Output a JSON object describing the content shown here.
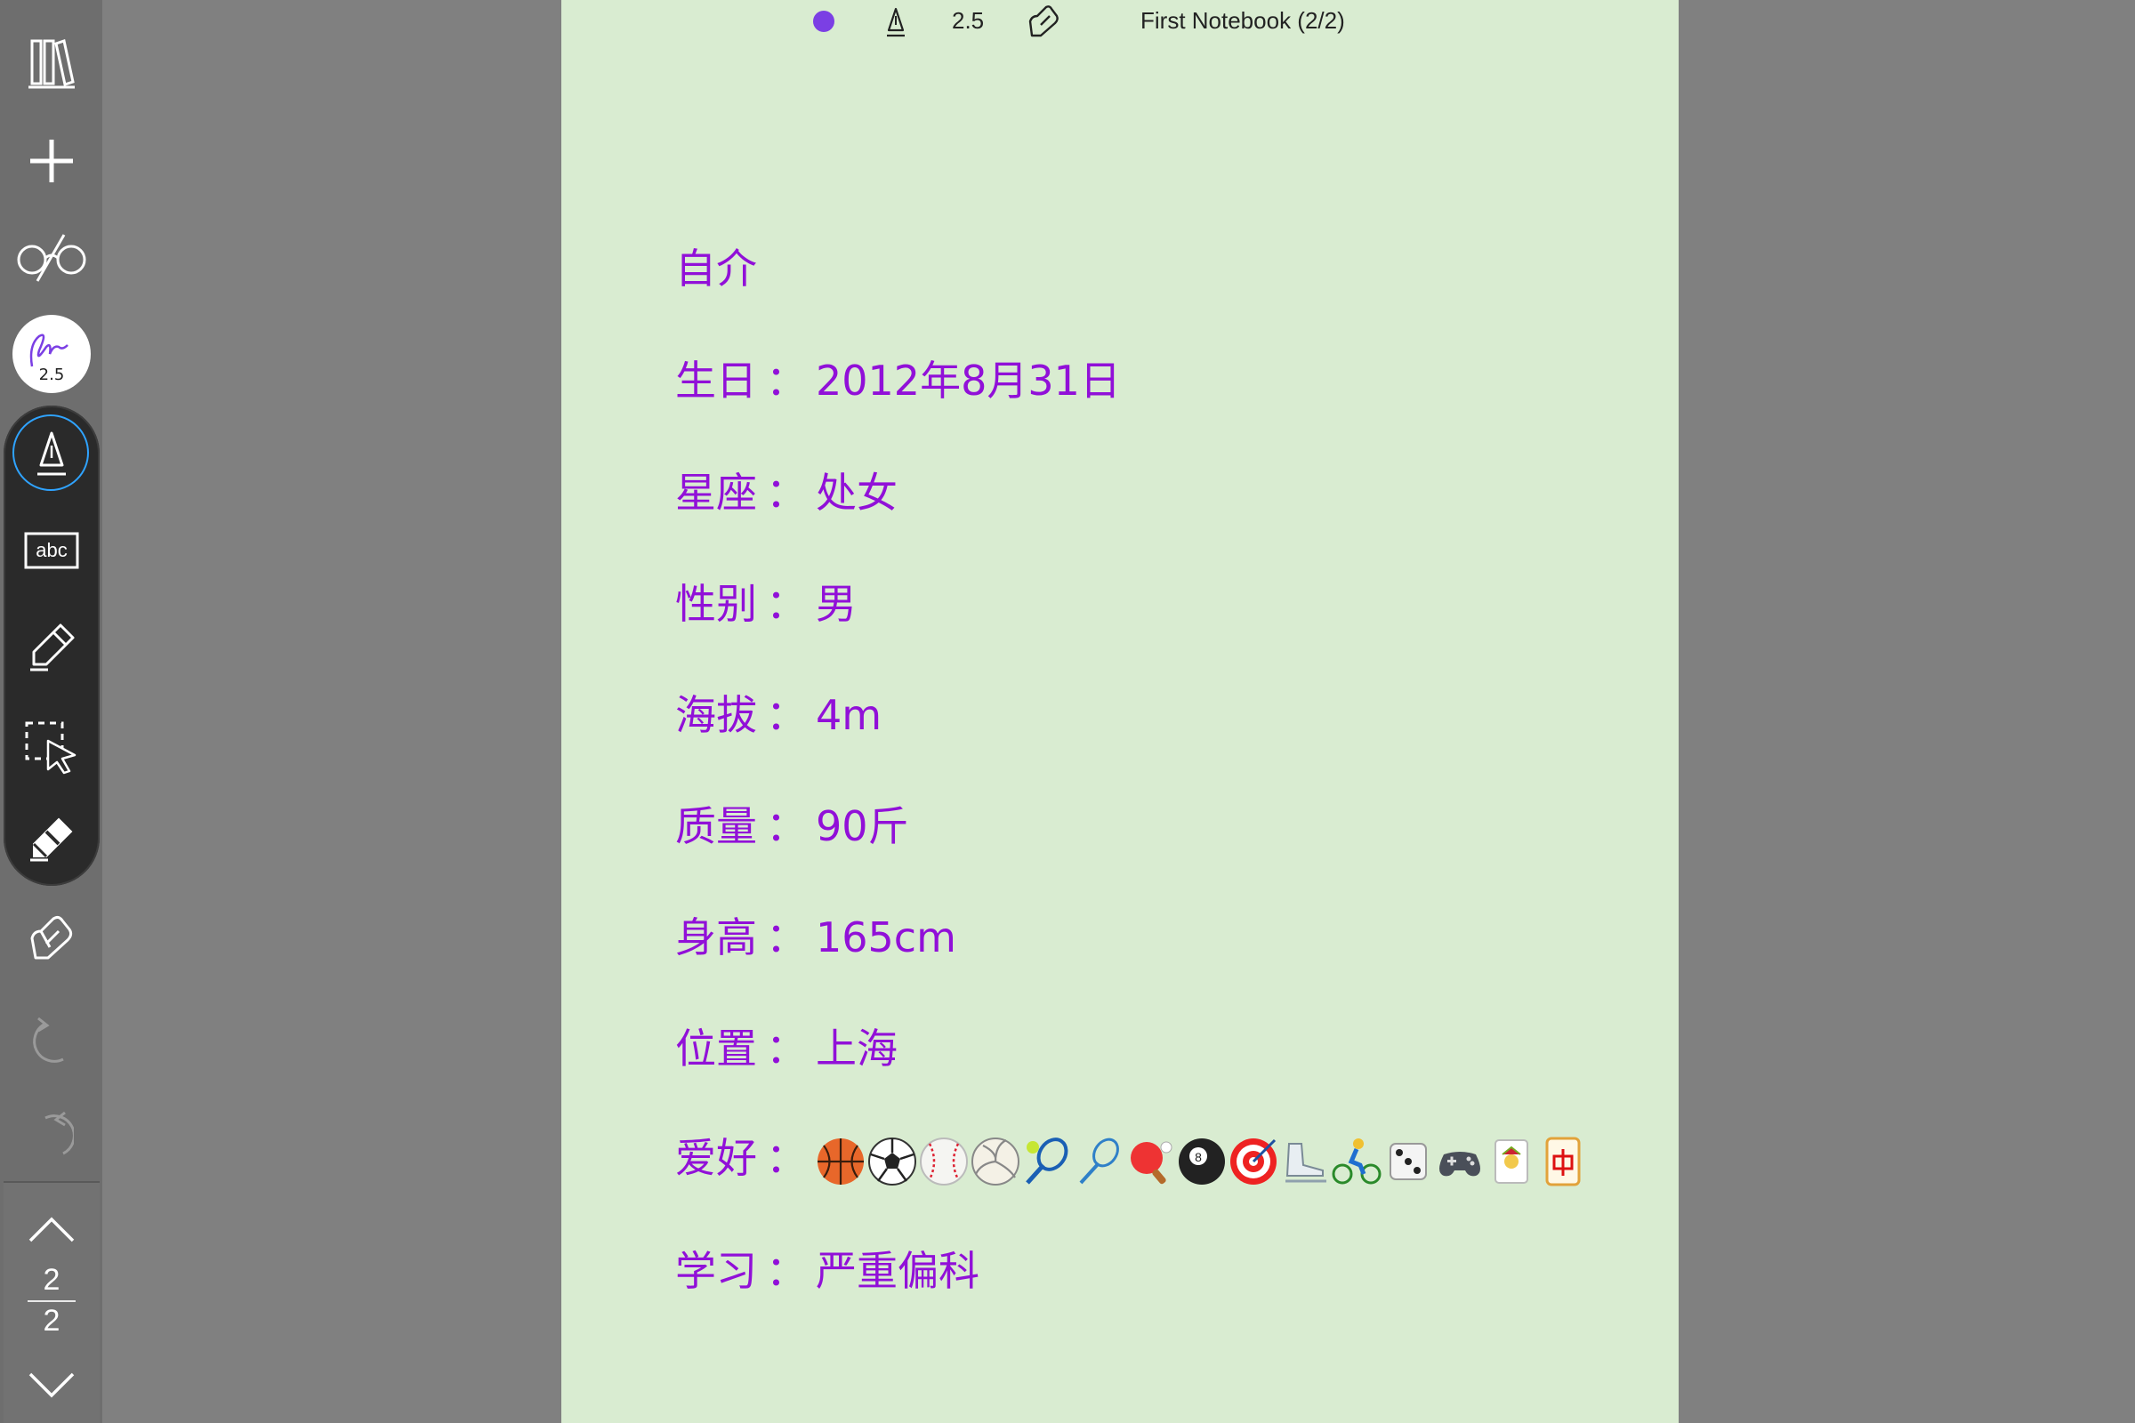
{
  "sidebar": {
    "pen_thumb_label": "2.5",
    "pager": {
      "current": "2",
      "total": "2"
    }
  },
  "topbar": {
    "pen_size": "2.5",
    "notebook_title": "First Notebook (2/2)",
    "ink_color": "#7b3fe4"
  },
  "note": {
    "ink_color": "#9110d8",
    "title": "自介",
    "lines": [
      {
        "label": "生日",
        "sep": "：",
        "value": "2012年8月31日"
      },
      {
        "label": "星座",
        "sep": "：",
        "value": "处女"
      },
      {
        "label": "性别",
        "sep": "：",
        "value": "男"
      },
      {
        "label": "海拔",
        "sep": "：",
        "value": "4m"
      },
      {
        "label": "质量",
        "sep": "：",
        "value": "90斤"
      },
      {
        "label": "身高",
        "sep": "：",
        "value": "165cm"
      },
      {
        "label": "位置",
        "sep": "：",
        "value": "上海"
      },
      {
        "label": "爱好",
        "sep": "：",
        "value": ""
      },
      {
        "label": "学习",
        "sep": "：",
        "value": "严重偏科"
      }
    ],
    "hobby_emojis": [
      "basketball-icon",
      "soccer-ball-icon",
      "baseball-icon",
      "volleyball-icon",
      "tennis-icon",
      "badminton-icon",
      "ping-pong-icon",
      "pool-8-ball-icon",
      "target-icon",
      "ice-skate-icon",
      "cyclist-icon",
      "dice-icon",
      "game-controller-icon",
      "joker-card-icon",
      "mahjong-tile-icon"
    ]
  }
}
